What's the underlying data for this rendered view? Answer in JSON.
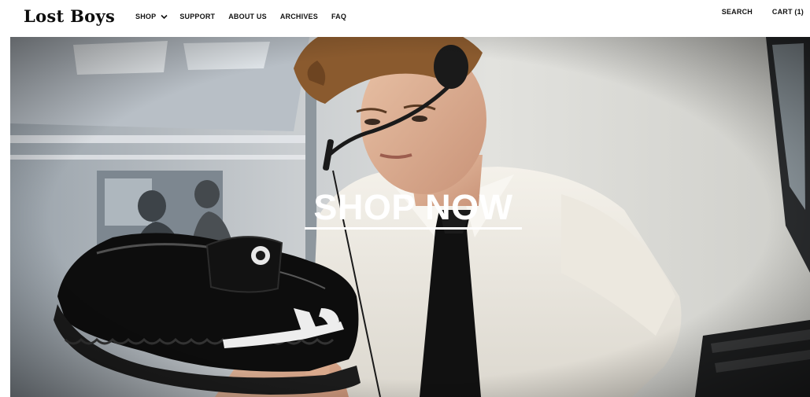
{
  "header": {
    "logo_text": "Lost Boys",
    "nav": {
      "shop_label": "SHOP",
      "support_label": "SUPPORT",
      "about_label": "ABOUT US",
      "archives_label": "ARCHIVES",
      "faq_label": "FAQ",
      "shop_icon": "chevron-down-icon"
    },
    "right": {
      "search_label": "SEARCH",
      "cart_label": "CART (1)"
    }
  },
  "hero": {
    "cta_label": "SHOP NOW",
    "cta_color": "#ffffff"
  }
}
